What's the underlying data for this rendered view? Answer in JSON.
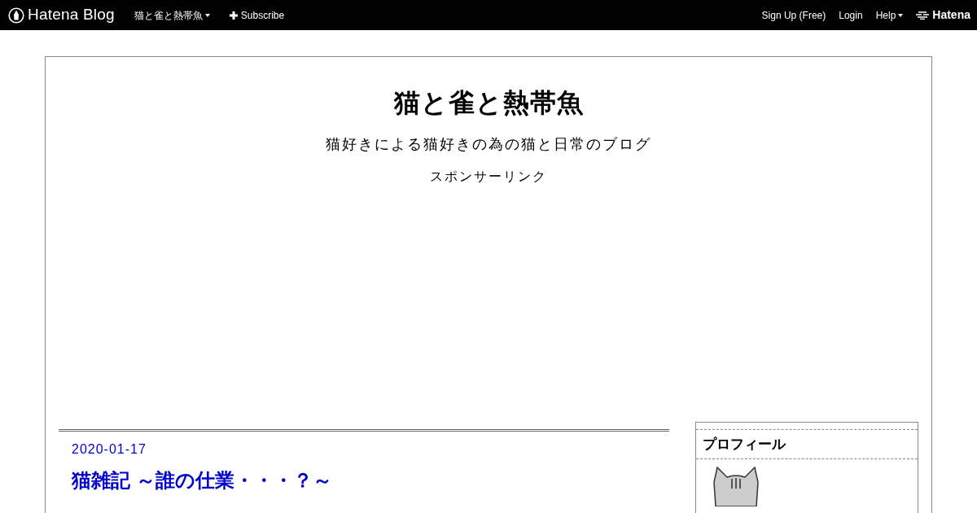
{
  "global_header": {
    "logo_text": "Hatena Blog",
    "blog_menu": "猫と雀と熱帯魚",
    "subscribe": "Subscribe",
    "sign_up": "Sign Up (Free)",
    "login": "Login",
    "help": "Help",
    "brand": "Hatena"
  },
  "blog": {
    "title": "猫と雀と熱帯魚",
    "description": "猫好きによる猫好きの為の猫と日常のブログ",
    "sponsored_label": "スポンサーリンク"
  },
  "entry": {
    "date": "2020-01-17",
    "title": "猫雑記 ～誰の仕業・・・？～"
  },
  "sidebar": {
    "module_title": "プロフィール"
  }
}
